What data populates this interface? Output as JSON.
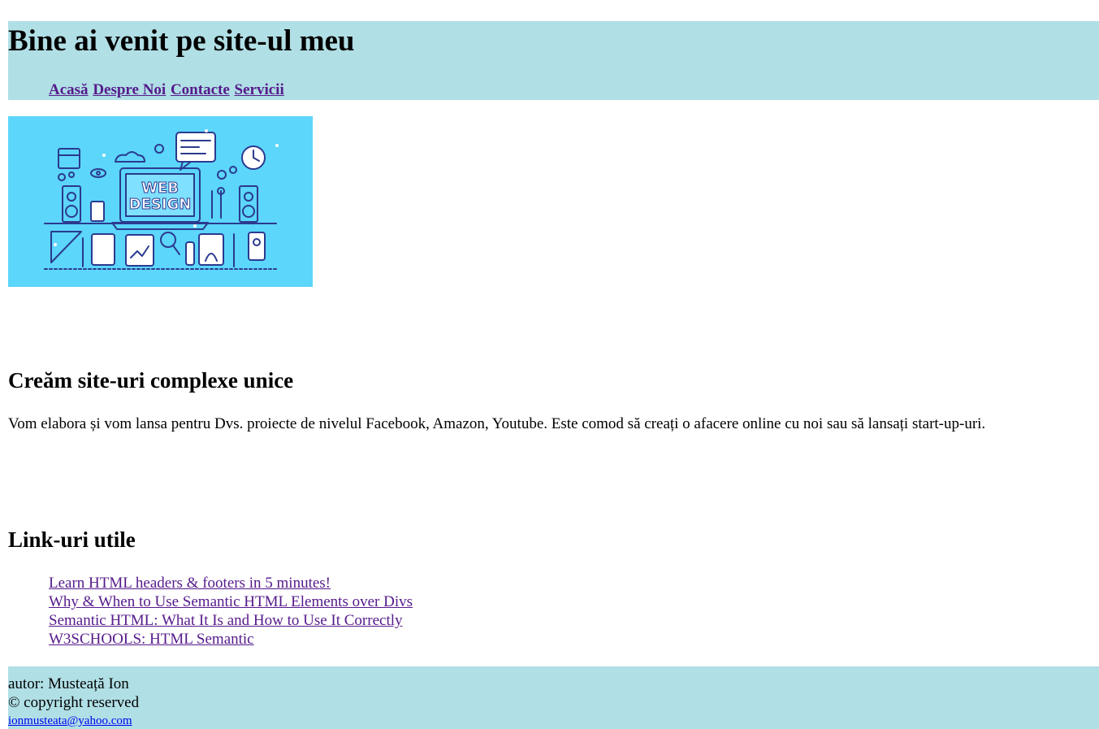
{
  "header": {
    "title": "Bine ai venit pe site-ul meu",
    "nav": [
      "Acasă",
      "Despre Noi",
      "Contacte",
      "Servicii"
    ]
  },
  "hero": {
    "text_line1": "WEB",
    "text_line2": "DESIGN",
    "background": "#5cd6fb"
  },
  "section1": {
    "title": "Creăm site-uri complexe unice",
    "text": "Vom elabora și vom lansa pentru Dvs. proiecte de nivelul Facebook, Amazon, Youtube. Este comod să creați o afacere online cu noi sau să lansați start-up-uri."
  },
  "section2": {
    "title": "Link-uri utile",
    "links": [
      "Learn HTML headers & footers in 5 minutes!",
      "Why & When to Use Semantic HTML Elements over Divs",
      "Semantic HTML: What It Is and How to Use It Correctly",
      "W3SCHOOLS: HTML Semantic"
    ]
  },
  "footer": {
    "author": "autor: Musteață Ion",
    "copyright": "© copyright reserved",
    "email": "ionmusteata@yahoo.com"
  },
  "colors": {
    "header_bg": "#b0dfe5",
    "link_visited": "#551a8b",
    "link": "#0000ee"
  }
}
